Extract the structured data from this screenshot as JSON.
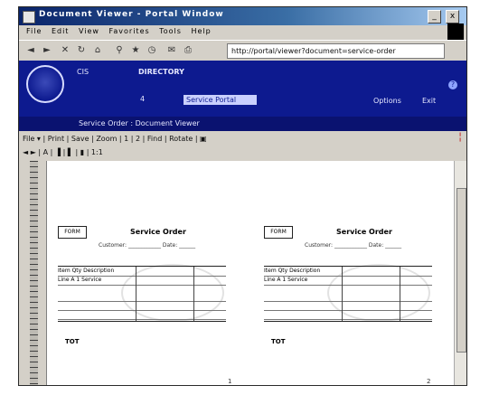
{
  "window": {
    "title": "Document Viewer - Portal Window",
    "min": "_",
    "close": "x"
  },
  "menu": [
    "File",
    "Edit",
    "View",
    "Favorites",
    "Tools",
    "Help"
  ],
  "toolbar": {
    "address": "http://portal/viewer?document=service-order"
  },
  "portal": {
    "app_label": "CIS",
    "system_label": "DIRECTORY",
    "line1_left": "4",
    "user": "Service Portal",
    "nav_right_1": "Options",
    "nav_right_2": "Exit",
    "breadcrumb": "Service Order : Document Viewer"
  },
  "apptoolbar": {
    "row1": "File ▾ | Print | Save | Zoom | 1 | 2 | Find | Rotate | ▣",
    "row2": "◄ ► | A | ▐ | ▌ | ▮ | 1:1"
  },
  "sheets": [
    {
      "hdr": "FORM",
      "title": "Service Order",
      "sub": "Customer: ____________  Date: ______",
      "rows": [
        "Item    Qty    Description",
        "Line A   1    Service",
        "",
        "",
        ""
      ],
      "mark": "TOT"
    },
    {
      "hdr": "FORM",
      "title": "Service Order",
      "sub": "Customer: ____________  Date: ______",
      "rows": [
        "Item    Qty    Description",
        "Line A   1    Service",
        "",
        "",
        ""
      ],
      "mark": "TOT"
    }
  ],
  "page_numbers": [
    "1",
    "2"
  ]
}
